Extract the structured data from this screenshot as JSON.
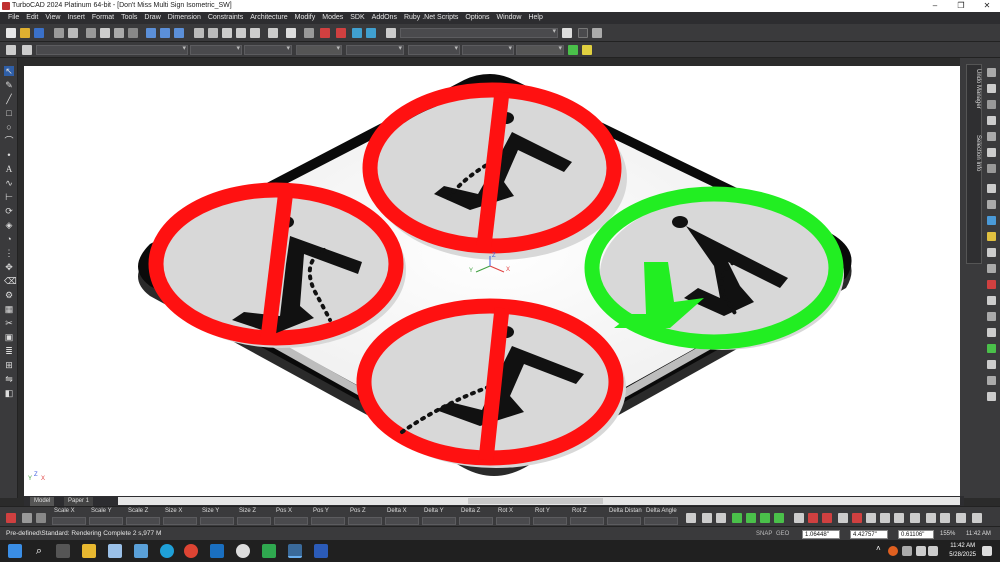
{
  "titlebar": {
    "title": "TurboCAD 2024 Platinum 64-bit - [Don't Miss Multi Sign Isometric_SW]"
  },
  "menu": [
    "File",
    "Edit",
    "View",
    "Insert",
    "Format",
    "Tools",
    "Draw",
    "Dimension",
    "Constraints",
    "Architecture",
    "Modify",
    "Modes",
    "SDK",
    "AddOns",
    "Ruby .Net Scripts",
    "Options",
    "Window",
    "Help"
  ],
  "right_panel": {
    "tabs": [
      "Undo Manager",
      "Selection Info"
    ]
  },
  "layout_tabs": [
    "Model",
    "Paper 1"
  ],
  "axis_labels": {
    "x": "X",
    "y": "Y",
    "z": "Z"
  },
  "properties": [
    "Scale X",
    "Scale Y",
    "Scale Z",
    "Size X",
    "Size Y",
    "Size Z",
    "Pos X",
    "Pos Y",
    "Pos Z",
    "Delta X",
    "Delta Y",
    "Delta Z",
    "Rot X",
    "Rot Y",
    "Rot Z",
    "Delta Distan",
    "Delta Angle"
  ],
  "status": {
    "text": "Pre-defined\\Standard: Rendering Complete 2 s,977 M",
    "snap": "SNAP",
    "geo": "GEO",
    "x": "1.06448\"",
    "y": "4.42757\"",
    "z": "0.61106\"",
    "zoom": "155%",
    "time": "11:42 AM"
  },
  "taskbar": {
    "time": "11:42 AM",
    "date": "5/28/2025"
  },
  "colors": {
    "prohibit": "#ff1111",
    "allow": "#22ee22",
    "figure": "#111111"
  }
}
